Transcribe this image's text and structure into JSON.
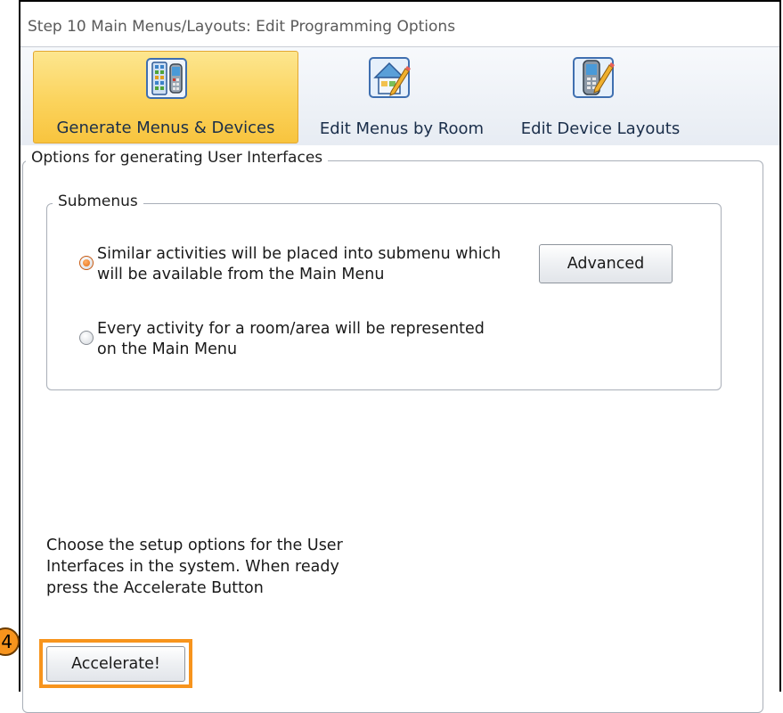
{
  "window": {
    "title": "Step 10 Main Menus/Layouts: Edit Programming Options"
  },
  "ribbon": {
    "buttons": [
      {
        "label": "Generate Menus & Devices",
        "icon": "menus-devices-icon",
        "active": true
      },
      {
        "label": "Edit Menus by Room",
        "icon": "house-edit-icon",
        "active": false
      },
      {
        "label": "Edit Device Layouts",
        "icon": "remote-edit-icon",
        "active": false
      }
    ]
  },
  "options_group": {
    "title": "Options for generating User Interfaces"
  },
  "submenus_group": {
    "title": "Submenus",
    "options": [
      {
        "label_line1": "Similar activities will be placed into submenu which",
        "label_line2": "will be available from the Main Menu",
        "checked": true
      },
      {
        "label_line1": "Every activity for a room/area will be represented",
        "label_line2": "on the Main Menu",
        "checked": false
      }
    ],
    "advanced_label": "Advanced"
  },
  "instructions": {
    "line1": "Choose the setup options for the User",
    "line2": "Interfaces in the system. When ready",
    "line3": "press the Accelerate Button"
  },
  "accelerate_label": "Accelerate!",
  "annotation": {
    "step_number": "4",
    "highlight_color": "#f7941d"
  },
  "colors": {
    "active_tab": "#fbd35c",
    "radio_checked": "#e66a10"
  }
}
